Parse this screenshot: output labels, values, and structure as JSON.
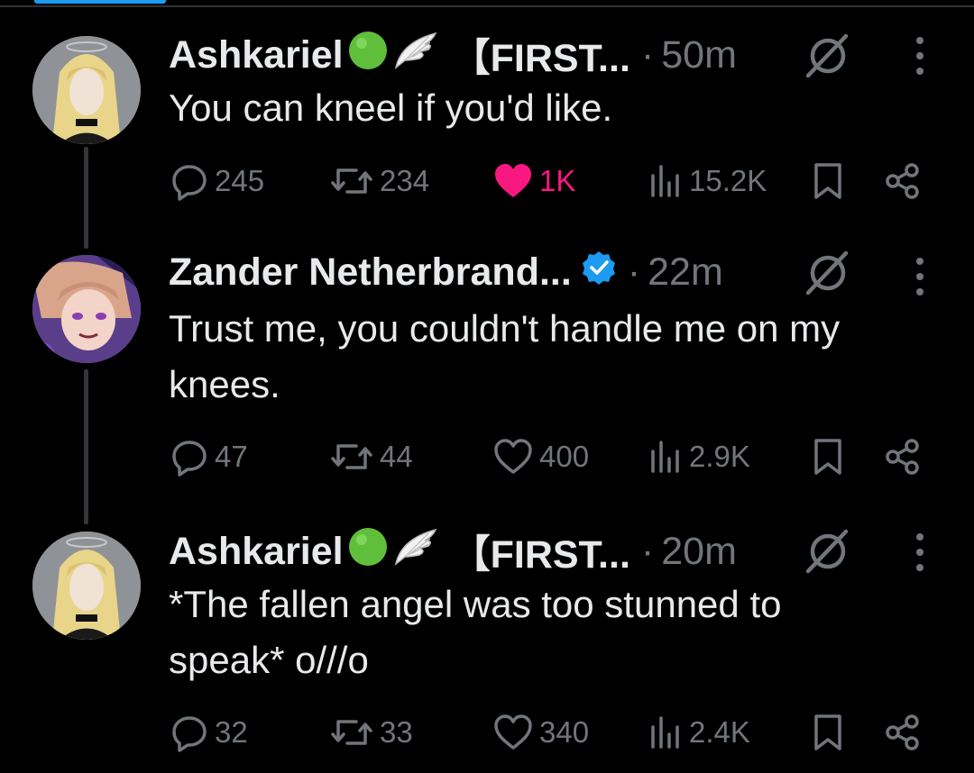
{
  "tweets": [
    {
      "name": "Ashkariel",
      "handle": "【FIRST...",
      "separator": "·",
      "time": "50m",
      "text": "You can kneel if you'd like.",
      "replies": "245",
      "reposts": "234",
      "likes": "1K",
      "liked": true,
      "views": "15.2K",
      "badge": "green-circle-and-wing-emoji"
    },
    {
      "name": "Zander Netherbrand...",
      "handle": "",
      "separator": "·",
      "time": "22m",
      "text": "Trust me, you couldn't handle me on my knees.",
      "replies": "47",
      "reposts": "44",
      "likes": "400",
      "liked": false,
      "views": "2.9K",
      "badge": "verified-badge"
    },
    {
      "name": "Ashkariel",
      "handle": "【FIRST...",
      "separator": "·",
      "time": "20m",
      "text": "*The fallen angel was too stunned to speak* o///o",
      "replies": "32",
      "reposts": "33",
      "likes": "340",
      "liked": false,
      "views": "2.4K",
      "badge": "green-circle-and-wing-emoji"
    }
  ],
  "colors": {
    "background": "#000000",
    "text": "#e7e9ea",
    "muted": "#71767b",
    "like": "#f91880",
    "verified": "#1d9bf0"
  }
}
